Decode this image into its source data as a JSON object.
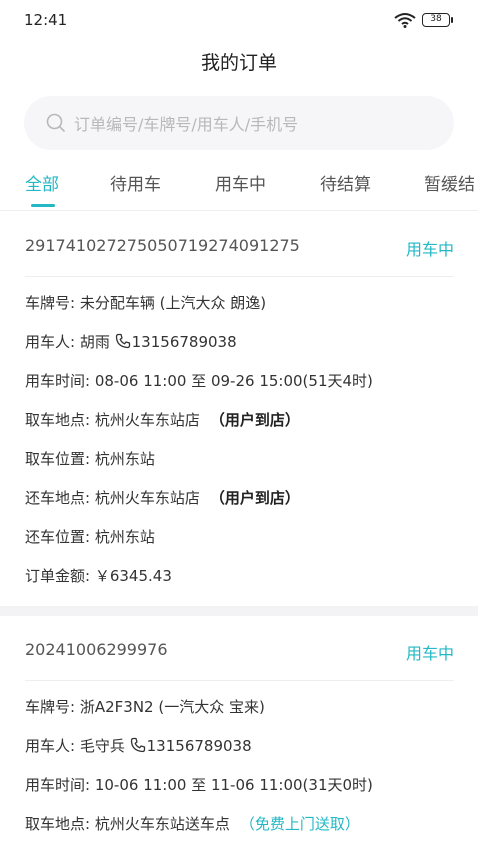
{
  "status_bar": {
    "time": "12:41",
    "battery": "38"
  },
  "header": {
    "title": "我的订单"
  },
  "search": {
    "placeholder": "订单编号/车牌号/用车人/手机号"
  },
  "tabs": [
    {
      "label": "全部",
      "active": true
    },
    {
      "label": "待用车",
      "active": false
    },
    {
      "label": "用车中",
      "active": false
    },
    {
      "label": "待结算",
      "active": false
    },
    {
      "label": "暂缓结",
      "active": false
    }
  ],
  "orders": [
    {
      "order_no": "29174102727505071927409​1275",
      "status": "用车中",
      "plate_label": "车牌号:",
      "plate_value": "未分配车辆 (上汽大众 朗逸)",
      "user_label": "用车人:",
      "user_name": "胡雨",
      "user_phone": "13156789038",
      "time_label": "用车时间:",
      "time_value": "08-06 11:00 至 09-26 15:00(51天4时)",
      "pickup_label": "取车地点:",
      "pickup_value": "杭州火车东站店",
      "pickup_tag": "（用户到店）",
      "pickup_pos_label": "取车位置:",
      "pickup_pos_value": "杭州东站",
      "return_label": "还车地点:",
      "return_value": "杭州火车东站店",
      "return_tag": "（用户到店）",
      "return_pos_label": "还车位置:",
      "return_pos_value": "杭州东站",
      "amount_label": "订单金额:",
      "amount_value": "￥6345.43"
    },
    {
      "order_no": "20241006299976",
      "status": "用车中",
      "plate_label": "车牌号:",
      "plate_value": "浙A2F3N2 (一汽大众 宝来)",
      "user_label": "用车人:",
      "user_name": "毛守兵",
      "user_phone": "13156789038",
      "time_label": "用车时间:",
      "time_value": "10-06 11:00 至 11-06 11:00(31天0时)",
      "pickup_label": "取车地点:",
      "pickup_value": "杭州火车东站送车点",
      "pickup_tag": "（免费上门送取）"
    }
  ],
  "colors": {
    "accent": "#23b8c4",
    "text": "#333333",
    "muted": "#b8b8bc"
  }
}
